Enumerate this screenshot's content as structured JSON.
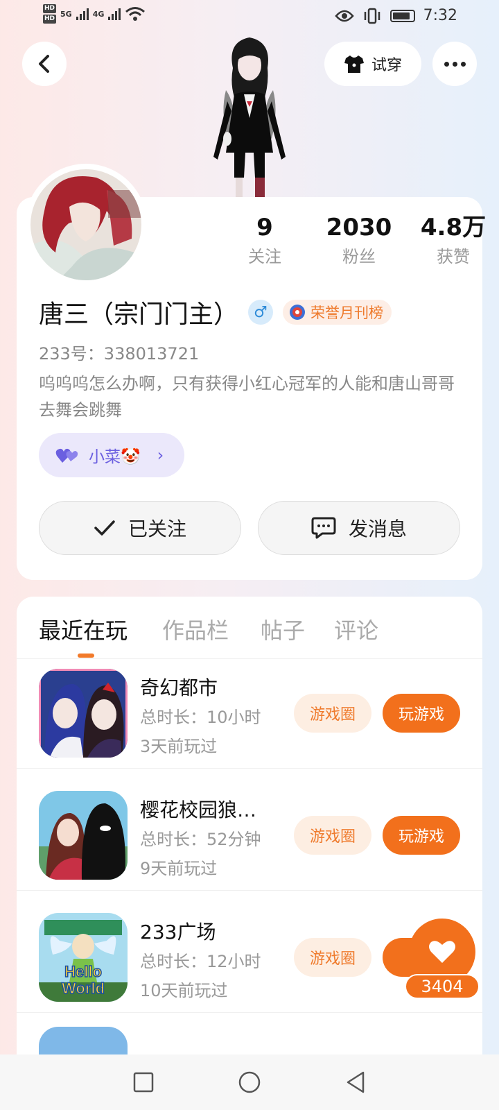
{
  "status": {
    "hd1": "HD",
    "hd2": "HD",
    "net1": "5G",
    "net2": "4G",
    "time": "7:32"
  },
  "header": {
    "tryon_label": "试穿"
  },
  "profile": {
    "stats": [
      {
        "value": "9",
        "label": "关注"
      },
      {
        "value": "2030",
        "label": "粉丝"
      },
      {
        "value": "4.8万",
        "label": "获赞"
      }
    ],
    "name": "唐三（宗门门主）",
    "gender_symbol": "♂",
    "honor_label": "荣誉月刊榜",
    "uid": "233号：338013721",
    "bio": "呜呜呜怎么办啊，只有获得小红心冠军的人能和唐山哥哥去舞会跳舞",
    "tag": "小菜🤡",
    "follow_label": "已关注",
    "message_label": "发消息"
  },
  "tabs": [
    "最近在玩",
    "作品栏",
    "帖子",
    "评论"
  ],
  "games": [
    {
      "name": "奇幻都市",
      "duration": "总时长：10小时",
      "last_played": "3天前玩过",
      "circle_label": "游戏圈",
      "play_label": "玩游戏"
    },
    {
      "name": "樱花校园狼…",
      "duration": "总时长：52分钟",
      "last_played": "9天前玩过",
      "circle_label": "游戏圈",
      "play_label": "玩游戏"
    },
    {
      "name": "233广场",
      "duration": "总时长：12小时",
      "last_played": "10天前玩过",
      "circle_label": "游戏圈",
      "play_label": "玩"
    }
  ],
  "like": {
    "count": "3404"
  },
  "colors": {
    "accent": "#f2701c",
    "tag_purple": "#6b5fe0",
    "honor_orange": "#ee7a2c"
  }
}
